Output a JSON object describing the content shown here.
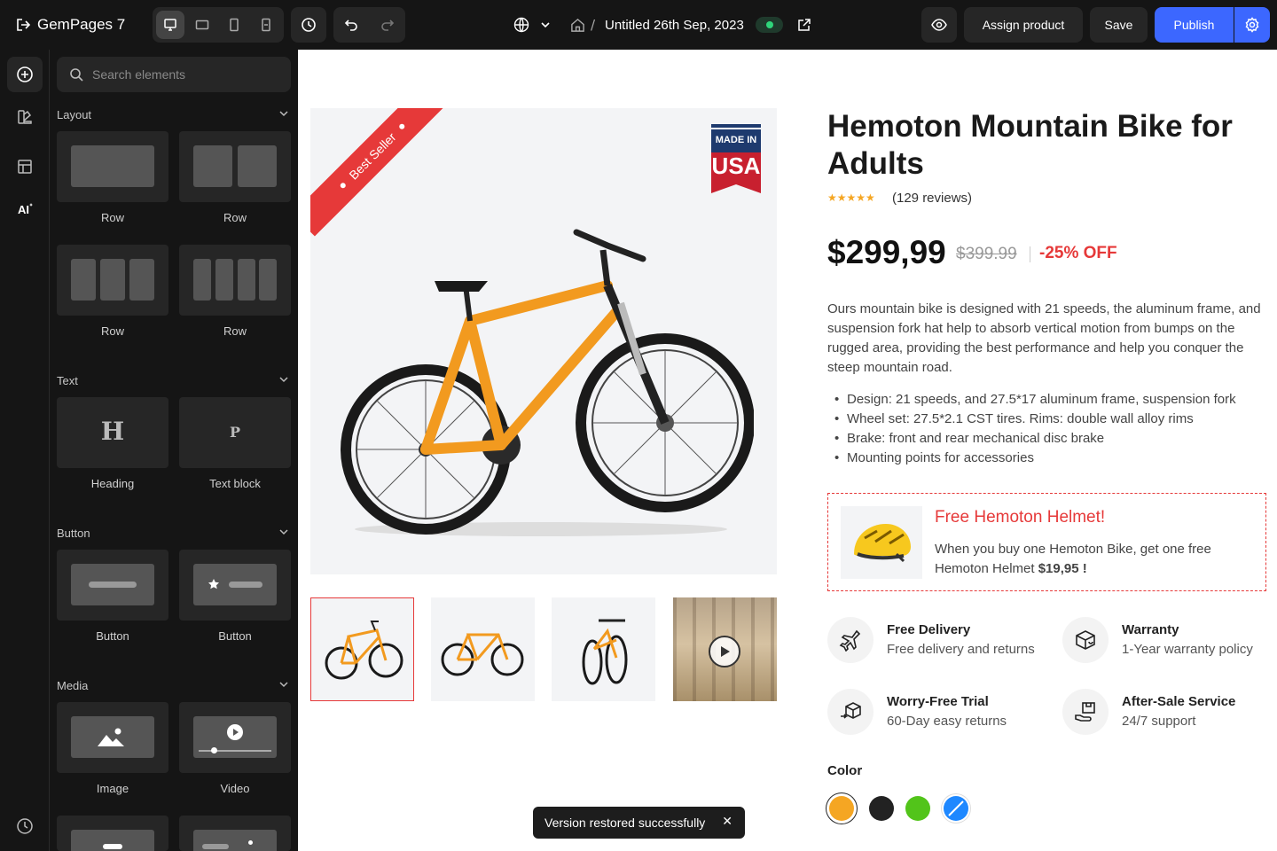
{
  "topbar": {
    "brand": "GemPages 7",
    "page_title": "Untitled 26th Sep, 2023",
    "breadcrumb_sep": "/",
    "assign_label": "Assign product",
    "save_label": "Save",
    "publish_label": "Publish",
    "accent_color": "#3c67ff"
  },
  "panel": {
    "search_placeholder": "Search elements",
    "sections": {
      "layout": "Layout",
      "text": "Text",
      "button": "Button",
      "media": "Media"
    },
    "tiles": {
      "row1": "Row",
      "row2": "Row",
      "row3": "Row",
      "row4": "Row",
      "heading": "Heading",
      "heading_glyph": "H",
      "textblock": "Text block",
      "textblock_glyph": "P",
      "button1": "Button",
      "button2": "Button",
      "image": "Image",
      "video": "Video"
    }
  },
  "product": {
    "title": "Hemoton Mountain Bike for Adults",
    "stars": "★★★★★",
    "reviews": "(129 reviews)",
    "price": "$299,99",
    "old_price": "$399.99",
    "discount": "-25% OFF",
    "ribbon": "Best Seller",
    "badge_top": "MADE IN",
    "badge_bottom": "USA",
    "description": "Ours mountain bike is designed with 21 speeds, the aluminum frame, and suspension fork hat help to absorb vertical motion from bumps on the rugged area, providing the best performance and help you conquer the steep mountain road.",
    "bullets": [
      "Design: 21 speeds, and 27.5*17 aluminum frame, suspension fork",
      "Wheel set: 27.5*2.1 CST tires. Rims: double wall alloy rims",
      "Brake: front and rear mechanical disc brake",
      "Mounting points for accessories"
    ],
    "promo_title": "Free Hemoton Helmet!",
    "promo_text": "When you buy one Hemoton Bike, get one free Hemoton Helmet",
    "promo_price": "$19,95 !",
    "features": [
      {
        "title": "Free Delivery",
        "sub": "Free delivery and returns",
        "icon": "plane-icon"
      },
      {
        "title": "Warranty",
        "sub": "1-Year warranty policy",
        "icon": "box-icon"
      },
      {
        "title": "Worry-Free Trial",
        "sub": "60-Day easy returns",
        "icon": "return-box-icon"
      },
      {
        "title": "After-Sale Service",
        "sub": "24/7 support",
        "icon": "support-box-icon"
      }
    ],
    "color_label": "Color",
    "colors": [
      "#f5a623",
      "#222222",
      "#52c41a",
      "#1e88ff"
    ],
    "selected_color": "#f5a623"
  },
  "toast": {
    "message": "Version restored successfully",
    "close": "✕"
  }
}
